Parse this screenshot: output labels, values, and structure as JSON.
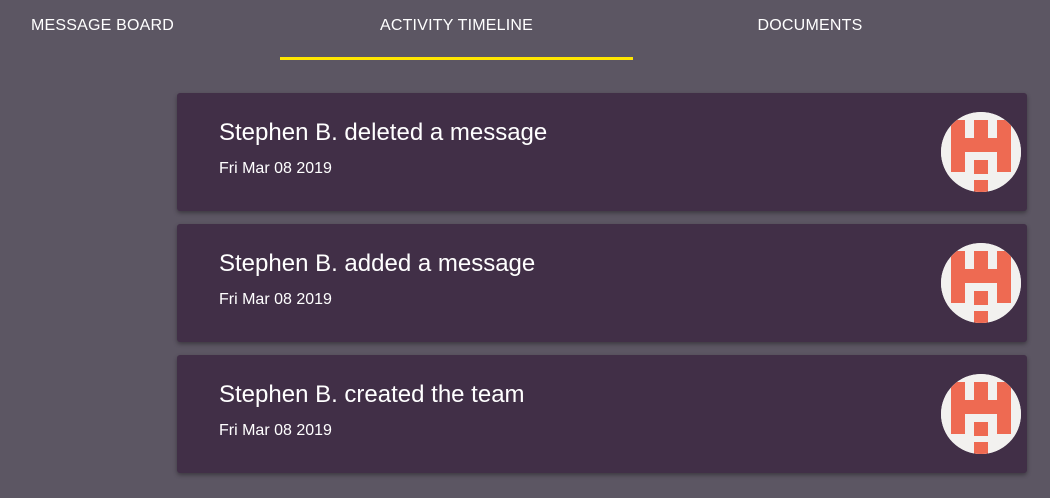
{
  "tabs": [
    {
      "label": "MESSAGE BOARD",
      "active": false
    },
    {
      "label": "ACTIVITY TIMELINE",
      "active": true
    },
    {
      "label": "DOCUMENTS",
      "active": false
    }
  ],
  "colors": {
    "background": "#5c5663",
    "card": "#412f47",
    "active_indicator": "#ffe600",
    "avatar_pattern": "#ee6a52",
    "avatar_background": "#f2f1ef"
  },
  "activity": [
    {
      "text": "Stephen B. deleted a message",
      "date": "Fri Mar 08 2019",
      "avatar": "identicon-avatar"
    },
    {
      "text": "Stephen B. added a message",
      "date": "Fri Mar 08 2019",
      "avatar": "identicon-avatar"
    },
    {
      "text": "Stephen B. created the team",
      "date": "Fri Mar 08 2019",
      "avatar": "identicon-avatar"
    }
  ]
}
